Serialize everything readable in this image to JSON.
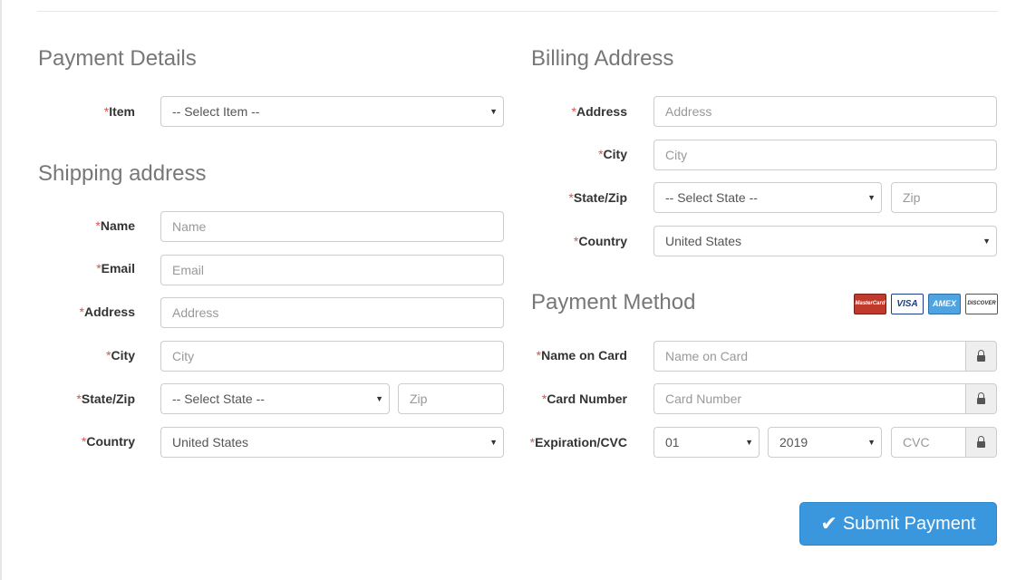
{
  "required_mark": "*",
  "payment_details": {
    "title": "Payment Details",
    "item_label": "Item",
    "item_select": "-- Select Item --"
  },
  "shipping": {
    "title": "Shipping address",
    "name_label": "Name",
    "name_placeholder": "Name",
    "email_label": "Email",
    "email_placeholder": "Email",
    "address_label": "Address",
    "address_placeholder": "Address",
    "city_label": "City",
    "city_placeholder": "City",
    "statezip_label": "State/Zip",
    "state_select": "-- Select State --",
    "zip_placeholder": "Zip",
    "country_label": "Country",
    "country_select": "United States"
  },
  "billing": {
    "title": "Billing Address",
    "address_label": "Address",
    "address_placeholder": "Address",
    "city_label": "City",
    "city_placeholder": "City",
    "statezip_label": "State/Zip",
    "state_select": "-- Select State --",
    "zip_placeholder": "Zip",
    "country_label": "Country",
    "country_select": "United States"
  },
  "payment_method": {
    "title": "Payment Method",
    "cards": [
      "MasterCard",
      "VISA",
      "AMEX",
      "DISCOVER"
    ],
    "name_on_card_label": "Name on Card",
    "name_on_card_placeholder": "Name on Card",
    "card_number_label": "Card Number",
    "card_number_placeholder": "Card Number",
    "expiration_label": "Expiration/CVC",
    "month_select": "01",
    "year_select": "2019",
    "cvc_placeholder": "CVC"
  },
  "submit_label": "Submit Payment",
  "colors": {
    "accent": "#3a96dd",
    "required": "#d9534f",
    "heading": "#777777"
  }
}
